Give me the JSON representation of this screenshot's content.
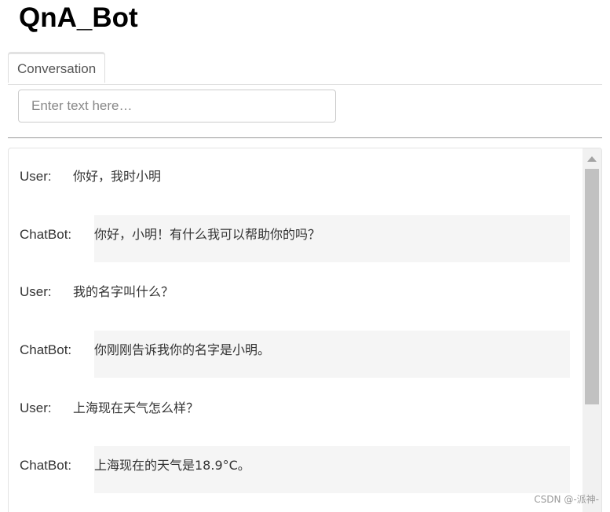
{
  "app": {
    "title": "QnA_Bot"
  },
  "tabs": [
    {
      "label": "Conversation"
    }
  ],
  "input": {
    "placeholder": "Enter text here…",
    "value": ""
  },
  "messages": [
    {
      "role": "User:",
      "text": "你好，我时小明"
    },
    {
      "role": "ChatBot:",
      "text": "你好，小明！有什么我可以帮助你的吗？"
    },
    {
      "role": "User:",
      "text": "我的名字叫什么？"
    },
    {
      "role": "ChatBot:",
      "text": "你刚刚告诉我你的名字是小明。"
    },
    {
      "role": "User:",
      "text": "上海现在天气怎么样？"
    },
    {
      "role": "ChatBot:",
      "text": "上海现在的天气是18.9°C。"
    }
  ],
  "watermark": "CSDN @-派神-"
}
